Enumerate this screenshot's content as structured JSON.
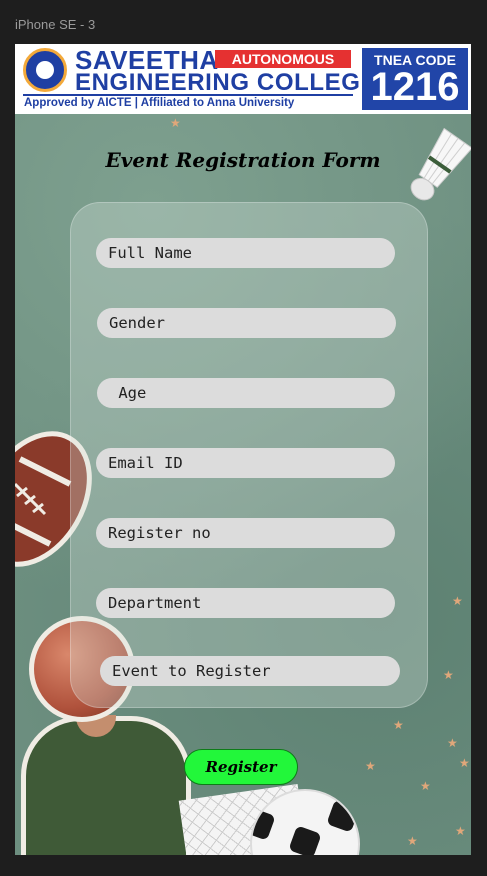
{
  "frame": {
    "label": "iPhone SE - 3"
  },
  "banner": {
    "name_line1": "SAVEETHA",
    "badge": "AUTONOMOUS",
    "name_line2": "ENGINEERING COLLEGE",
    "subline": "Approved by AICTE | Affiliated to Anna University",
    "tnea_label": "TNEA CODE",
    "tnea_code": "1216",
    "colors": {
      "primary": "#1f3fa3",
      "badge": "#e53131",
      "tnea_bg": "#2145a8"
    }
  },
  "form": {
    "title": "Event Registration Form",
    "fields": {
      "full_name": {
        "placeholder": "Full Name"
      },
      "gender": {
        "placeholder": "Gender"
      },
      "age": {
        "placeholder": " Age"
      },
      "email": {
        "placeholder": "Email ID"
      },
      "register_no": {
        "placeholder": "Register no"
      },
      "department": {
        "placeholder": "Department"
      },
      "event": {
        "placeholder": "Event to Register"
      }
    },
    "submit_label": "Register",
    "colors": {
      "button": "#22f73a",
      "field_bg": "#dcdcdc",
      "background": "#6d8f80"
    }
  },
  "decorations": {
    "icons": [
      "shuttlecock-icon",
      "american-football-icon",
      "basketball-icon",
      "soccer-ball-icon"
    ]
  }
}
